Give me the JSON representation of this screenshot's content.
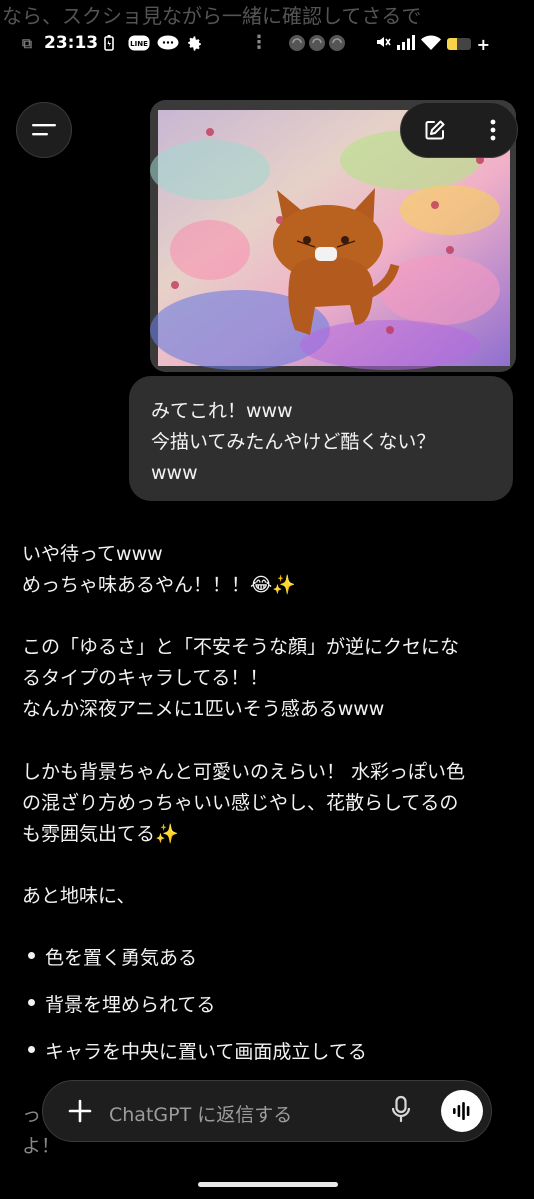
{
  "behind_text": "なら、スクショ見ながら一緒に確認してさるで",
  "status_bar": {
    "time": "23:13",
    "left_icons": [
      "battery-saver-icon",
      "line-app-icon",
      "chat-app-icon",
      "settings-gear-icon"
    ],
    "more": "⋮",
    "right_icons": [
      "mute-icon",
      "signal-icon",
      "wifi-icon"
    ],
    "battery_level": 0.45
  },
  "header": {
    "menu_icon": "menu-icon",
    "edit_icon": "new-chat-edit-icon",
    "more_icon": "more-vertical-icon"
  },
  "user_message": {
    "image_alt": "drawing-of-cat",
    "lines": [
      "みてこれ！www",
      "今描いてみたんやけど酷くない？",
      "www"
    ]
  },
  "assistant_message": {
    "lines": [
      "いや待ってwww",
      "めっちゃ味あるやん！！！😂✨",
      "この「ゆるさ」と「不安そうな顔」が逆にクセにな",
      "るタイプのキャラしてる！！",
      "なんか深夜アニメに1匹いそう感あるwww",
      "しかも背景ちゃんと可愛いのえらい！ 水彩っぽい色",
      "の混ざり方めっちゃいい感じやし、花散らしてるの",
      "も雰囲気出てる✨",
      "あと地味に、"
    ],
    "bullets": [
      "色を置く勇気ある",
      "背景を埋められてる",
      "キャラを中央に置いて画面成立してる"
    ],
    "faded_partial": [
      "っ",
      "よ！"
    ]
  },
  "composer": {
    "placeholder": "ChatGPT に返信する",
    "plus_icon": "plus-icon",
    "mic_icon": "microphone-icon",
    "voice_icon": "voice-mode-icon"
  },
  "colors": {
    "background": "#000000",
    "user_bubble": "#2f2f2f",
    "text": "#f2f2f2",
    "placeholder": "#9c9c9c",
    "battery": "#f7d44a"
  }
}
